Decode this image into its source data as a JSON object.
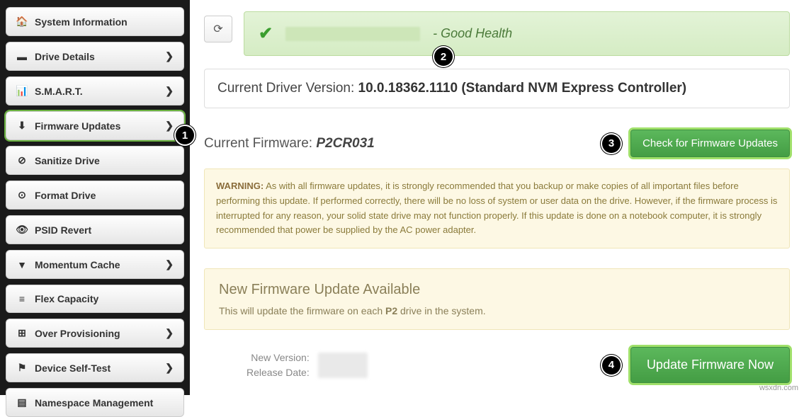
{
  "sidebar": {
    "items": [
      {
        "label": "System Information",
        "icon": "🏠",
        "chev": false,
        "active": false,
        "name": "nav-system-information"
      },
      {
        "label": "Drive Details",
        "icon": "▬",
        "chev": true,
        "active": false,
        "name": "nav-drive-details"
      },
      {
        "label": "S.M.A.R.T.",
        "icon": "📊",
        "chev": true,
        "active": false,
        "name": "nav-smart"
      },
      {
        "label": "Firmware Updates",
        "icon": "⬇",
        "chev": true,
        "active": true,
        "name": "nav-firmware-updates"
      },
      {
        "label": "Sanitize Drive",
        "icon": "⊘",
        "chev": false,
        "active": false,
        "name": "nav-sanitize-drive"
      },
      {
        "label": "Format Drive",
        "icon": "⊙",
        "chev": false,
        "active": false,
        "name": "nav-format-drive"
      },
      {
        "label": "PSID Revert",
        "icon": "👁",
        "chev": false,
        "active": false,
        "name": "nav-psid-revert"
      },
      {
        "label": "Momentum Cache",
        "icon": "▼",
        "chev": true,
        "active": false,
        "name": "nav-momentum-cache"
      },
      {
        "label": "Flex Capacity",
        "icon": "≡",
        "chev": false,
        "active": false,
        "name": "nav-flex-capacity"
      },
      {
        "label": "Over Provisioning",
        "icon": "⊞",
        "chev": true,
        "active": false,
        "name": "nav-over-provisioning"
      },
      {
        "label": "Device Self-Test",
        "icon": "⚑",
        "chev": true,
        "active": false,
        "name": "nav-device-self-test"
      },
      {
        "label": "Namespace Management",
        "icon": "▤",
        "chev": false,
        "active": false,
        "name": "nav-namespace-mgmt"
      }
    ]
  },
  "health": {
    "status": "- Good Health"
  },
  "driver": {
    "label": "Current Driver Version: ",
    "value": "10.0.18362.1110 (Standard NVM Express Controller)"
  },
  "firmware": {
    "label": "Current Firmware: ",
    "value": "P2CR031",
    "check_btn": "Check for Firmware Updates"
  },
  "warning": {
    "prefix": "WARNING:",
    "text": " As with all firmware updates, it is strongly recommended that you backup or make copies of all important files before performing this update. If performed correctly, there will be no loss of system or user data on the drive. However, if the firmware process is interrupted for any reason, your solid state drive may not function properly. If this update is done on a notebook computer, it is strongly recommended that power be supplied by the AC power adapter."
  },
  "available": {
    "title": "New Firmware Update Available",
    "desc_pre": "This will update the firmware on each ",
    "desc_bold": "P2",
    "desc_post": " drive in the system."
  },
  "meta": {
    "new_version_label": "New Version:",
    "release_date_label": "Release Date:",
    "update_btn": "Update Firmware Now"
  },
  "callouts": {
    "c1": "1",
    "c2": "2",
    "c3": "3",
    "c4": "4"
  },
  "watermark": "wsxdn.com"
}
